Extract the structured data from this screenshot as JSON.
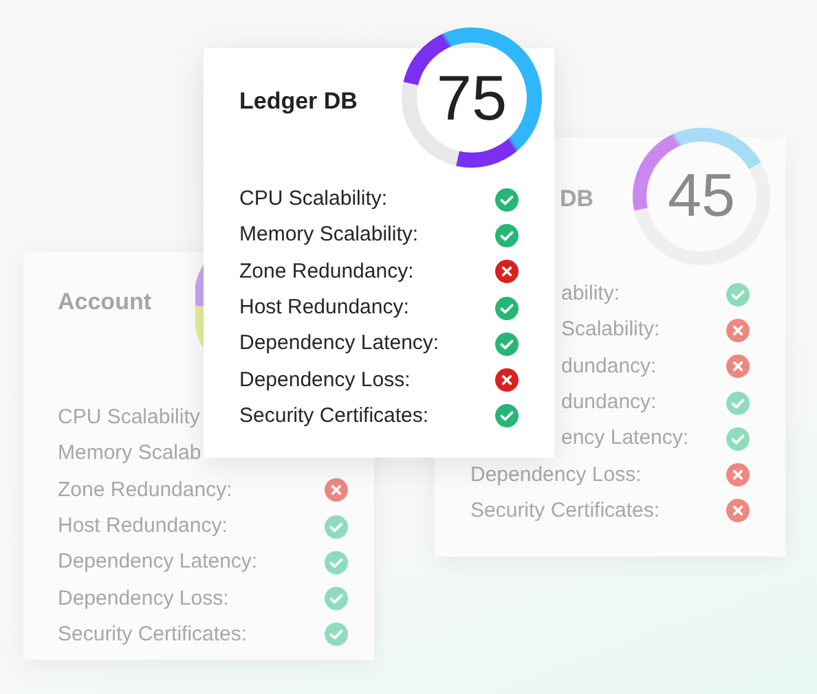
{
  "front_card": {
    "title": "Ledger DB",
    "score": "75",
    "level": 0.75,
    "rows": [
      {
        "label": "CPU Scalability:",
        "passed": true
      },
      {
        "label": "Memory Scalability:",
        "passed": true
      },
      {
        "label": "Zone Redundancy:",
        "passed": false
      },
      {
        "label": "Host Redundancy:",
        "passed": true
      },
      {
        "label": "Dependency Latency:",
        "passed": true
      },
      {
        "label": "Dependency Loss:",
        "passed": false
      },
      {
        "label": "Security Certificates:",
        "passed": true
      }
    ]
  },
  "right_card": {
    "title": "DB",
    "score": "45",
    "level": 0.45,
    "rows": [
      {
        "label": "ability:",
        "passed": true
      },
      {
        "label": "Scalability:",
        "passed": false
      },
      {
        "label": "dundancy:",
        "passed": false
      },
      {
        "label": "dundancy:",
        "passed": true
      },
      {
        "label": "ency Latency:",
        "passed": true
      },
      {
        "label": "Dependency Loss:",
        "passed": false
      },
      {
        "label": "Security Certificates:",
        "passed": false
      }
    ]
  },
  "left_card": {
    "title": "Account",
    "rows": [
      {
        "label": "CPU Scalability"
      },
      {
        "label": "Memory Scalab"
      },
      {
        "label": "Zone Redundancy:",
        "passed": false
      },
      {
        "label": "Host Redundancy:",
        "passed": true
      },
      {
        "label": "Dependency Latency:",
        "passed": true
      },
      {
        "label": "Dependency Loss:",
        "passed": true
      },
      {
        "label": "Security Certificates:",
        "passed": true
      }
    ]
  }
}
